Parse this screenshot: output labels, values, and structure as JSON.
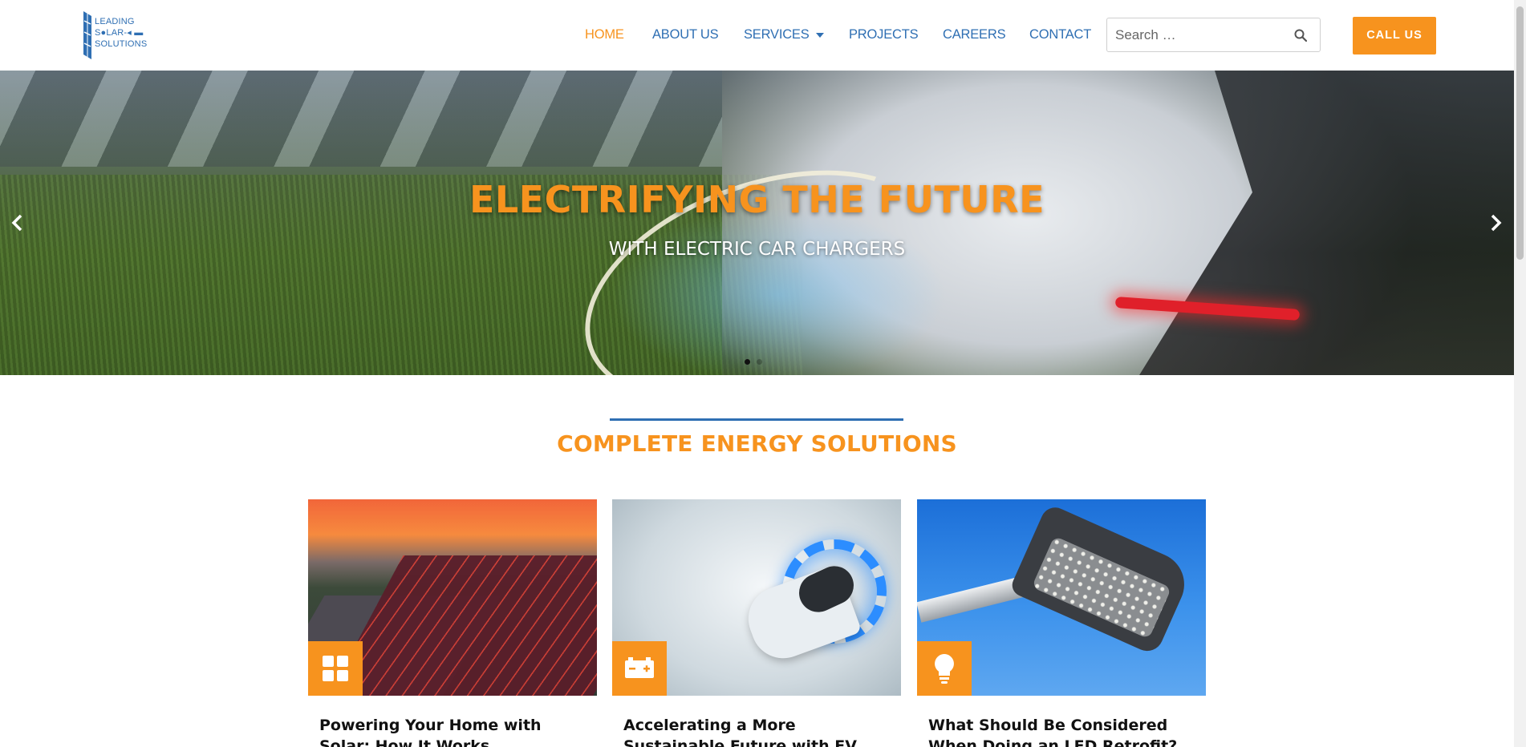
{
  "logo": {
    "line1": "LEADING",
    "line2": "S●LAR-◂ ▬",
    "line3": "SOLUTIONS"
  },
  "nav": {
    "items": [
      {
        "label": "HOME",
        "active": true
      },
      {
        "label": "ABOUT US"
      },
      {
        "label": "SERVICES",
        "has_dropdown": true
      },
      {
        "label": "PROJECTS"
      },
      {
        "label": "CAREERS"
      },
      {
        "label": "CONTACT"
      }
    ]
  },
  "search": {
    "placeholder": "Search …",
    "value": ""
  },
  "call_button": {
    "label": "CALL US"
  },
  "hero": {
    "title": "ELECTRIFYING THE FUTURE",
    "subtitle": "WITH ELECTRIC CAR CHARGERS",
    "prev_icon": "chevron-left-icon",
    "next_icon": "chevron-right-icon",
    "slides": 2,
    "active_slide": 1
  },
  "section": {
    "title": "COMPLETE ENERGY SOLUTIONS"
  },
  "cards": [
    {
      "title": "Powering Your Home with Solar: How It Works",
      "icon": "solar-panel-icon"
    },
    {
      "title": "Accelerating a More Sustainable Future with EV Chargers",
      "icon": "battery-icon"
    },
    {
      "title": "What Should Be Considered When Doing an LED Retrofit?",
      "icon": "lightbulb-icon"
    }
  ],
  "colors": {
    "accent": "#f7931e",
    "brand_blue": "#2f6fb3"
  }
}
